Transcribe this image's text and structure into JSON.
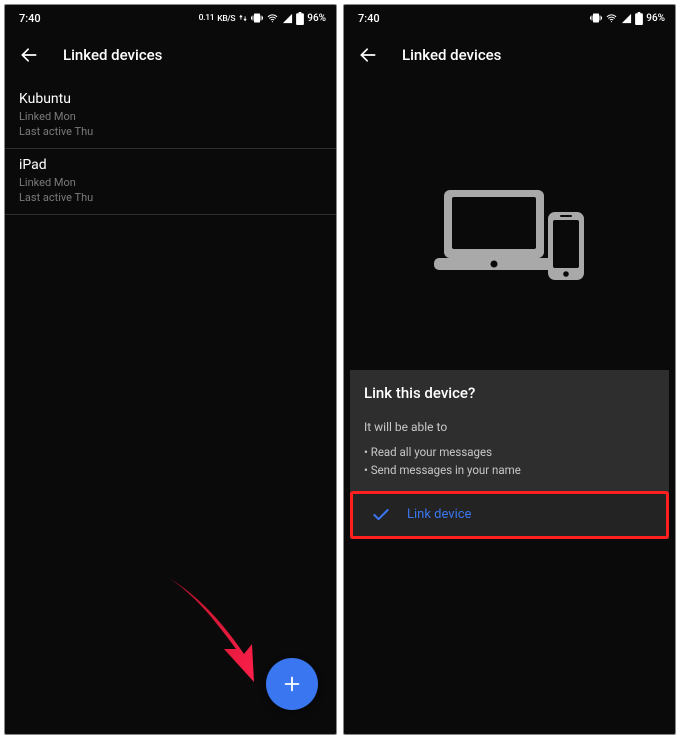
{
  "left": {
    "status": {
      "time": "7:40",
      "net": "0.11",
      "kbps": "KB/S",
      "battery": "96%"
    },
    "header": {
      "title": "Linked devices"
    },
    "devices": [
      {
        "name": "Kubuntu",
        "linked": "Linked Mon",
        "active": "Last active Thu"
      },
      {
        "name": "iPad",
        "linked": "Linked Mon",
        "active": "Last active Thu"
      }
    ]
  },
  "right": {
    "status": {
      "time": "7:40",
      "battery": "96%"
    },
    "header": {
      "title": "Linked devices"
    },
    "dialog": {
      "title": "Link this device?",
      "desc": "It will be able to",
      "b1": "• Read all your messages",
      "b2": "• Send messages in your name",
      "action": "Link device"
    }
  }
}
